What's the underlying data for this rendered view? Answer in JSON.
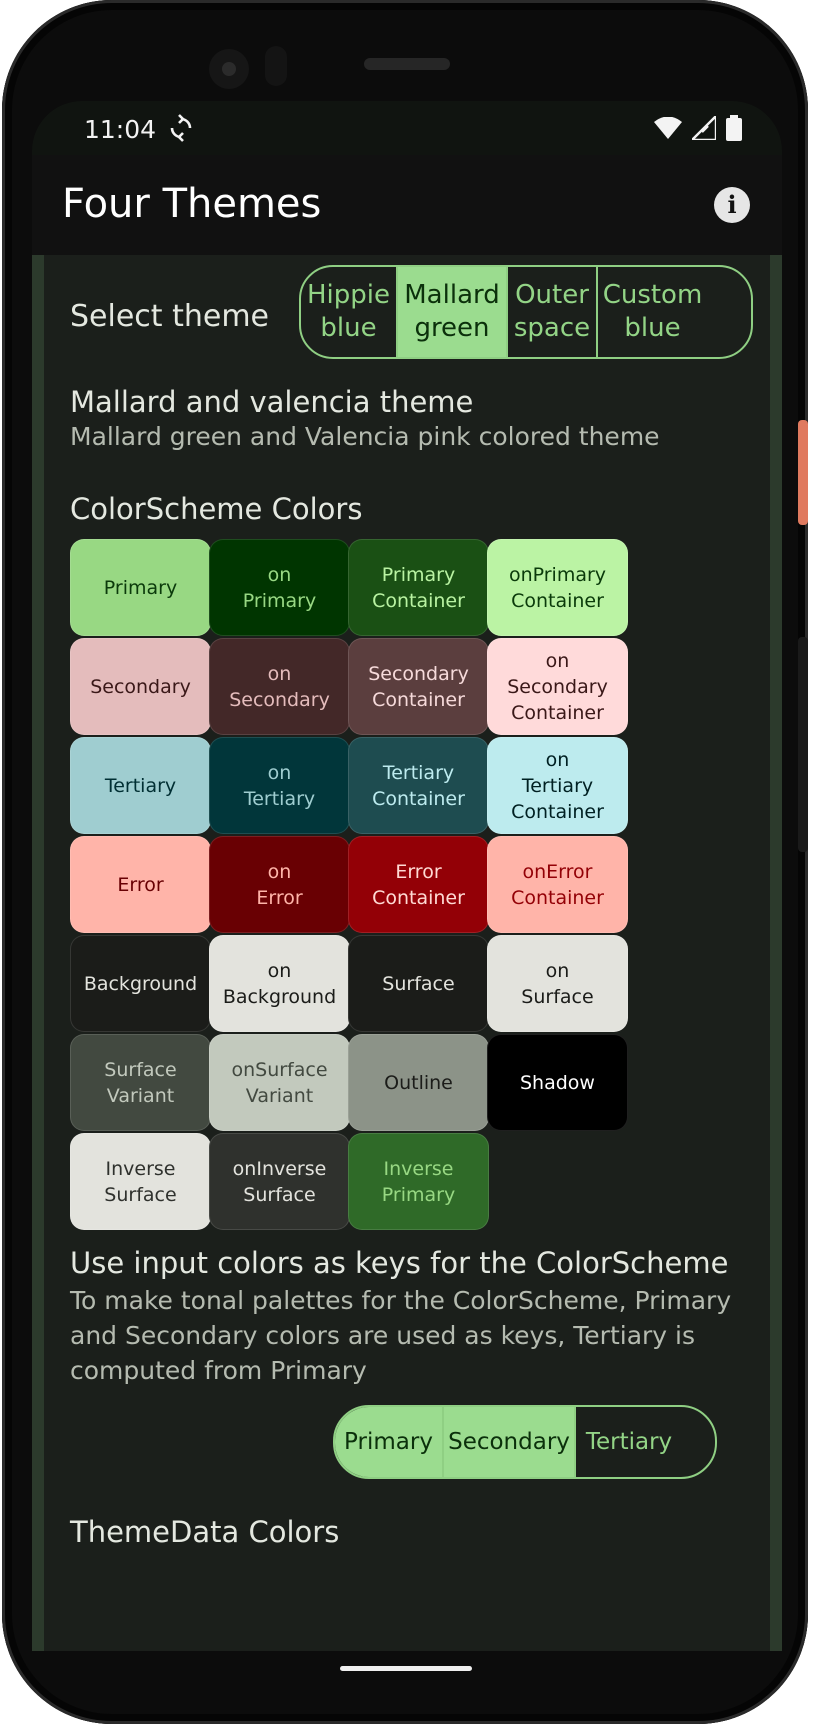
{
  "status_bar": {
    "time": "11:04"
  },
  "app_bar": {
    "title": "Four Themes"
  },
  "theme_select": {
    "label": "Select theme",
    "options": [
      {
        "label": "Hippie\nblue",
        "selected": false
      },
      {
        "label": "Mallard\ngreen",
        "selected": true
      },
      {
        "label": "Outer\nspace",
        "selected": false
      },
      {
        "label": "Custom\nblue",
        "selected": false
      }
    ]
  },
  "theme_info": {
    "name": "Mallard and valencia theme",
    "description": "Mallard green and Valencia pink colored theme"
  },
  "color_scheme": {
    "title": "ColorScheme Colors",
    "chips": [
      {
        "label": "Primary",
        "bg": "#98d883",
        "fg": "#0b3a0b"
      },
      {
        "label": "on\nPrimary",
        "bg": "#003500",
        "fg": "#98d883"
      },
      {
        "label": "Primary\nContainer",
        "bg": "#1a5014",
        "fg": "#b9f3a2"
      },
      {
        "label": "onPrimary\nContainer",
        "bg": "#bbf3a4",
        "fg": "#0a3a0a"
      },
      {
        "label": "Secondary",
        "bg": "#e4bcbc",
        "fg": "#3a1818"
      },
      {
        "label": "on\nSecondary",
        "bg": "#432828",
        "fg": "#e4bcbc"
      },
      {
        "label": "Secondary\nContainer",
        "bg": "#5b3e3e",
        "fg": "#f6dada"
      },
      {
        "label": "on\nSecondary\nContainer",
        "bg": "#ffdada",
        "fg": "#3a1818"
      },
      {
        "label": "Tertiary",
        "bg": "#9fcdd0",
        "fg": "#002f33"
      },
      {
        "label": "on\nTertiary",
        "bg": "#01363a",
        "fg": "#9fcdd0"
      },
      {
        "label": "Tertiary\nContainer",
        "bg": "#1e4c50",
        "fg": "#bdebef"
      },
      {
        "label": "on\nTertiary\nContainer",
        "bg": "#bdebee",
        "fg": "#002022"
      },
      {
        "label": "Error",
        "bg": "#ffb4a9",
        "fg": "#680003"
      },
      {
        "label": "on\nError",
        "bg": "#690003",
        "fg": "#ffb4a9"
      },
      {
        "label": "Error\nContainer",
        "bg": "#930006",
        "fg": "#ffdad4"
      },
      {
        "label": "onError\nContainer",
        "bg": "#ffb4a9",
        "fg": "#930006"
      },
      {
        "label": "Background",
        "bg": "#1b1c19",
        "fg": "#e3e3dd"
      },
      {
        "label": "on\nBackground",
        "bg": "#e3e3dd",
        "fg": "#1b1c19"
      },
      {
        "label": "Surface",
        "bg": "#1b1c19",
        "fg": "#e3e3dd"
      },
      {
        "label": "on\nSurface",
        "bg": "#e3e3dd",
        "fg": "#1b1c19"
      },
      {
        "label": "Surface\nVariant",
        "bg": "#424940",
        "fg": "#c2c9bd"
      },
      {
        "label": "onSurface\nVariant",
        "bg": "#c2c9bd",
        "fg": "#424940"
      },
      {
        "label": "Outline",
        "bg": "#8c9388",
        "fg": "#1b1c19"
      },
      {
        "label": "Shadow",
        "bg": "#000000",
        "fg": "#ffffff"
      },
      {
        "label": "Inverse\nSurface",
        "bg": "#e3e3dd",
        "fg": "#2f312d"
      },
      {
        "label": "onInverse\nSurface",
        "bg": "#2f312d",
        "fg": "#e3e3dd"
      },
      {
        "label": "Inverse\nPrimary",
        "bg": "#2f6a28",
        "fg": "#98d883"
      }
    ]
  },
  "input_colors": {
    "title": "Use input colors as keys for the ColorScheme",
    "description": "To make tonal palettes for the ColorScheme, Primary and Secondary colors are used as keys, Tertiary is computed from Primary",
    "options": [
      {
        "label": "Primary",
        "selected": true
      },
      {
        "label": "Secondary",
        "selected": true
      },
      {
        "label": "Tertiary",
        "selected": false
      }
    ]
  },
  "theme_data": {
    "title": "ThemeData Colors"
  }
}
